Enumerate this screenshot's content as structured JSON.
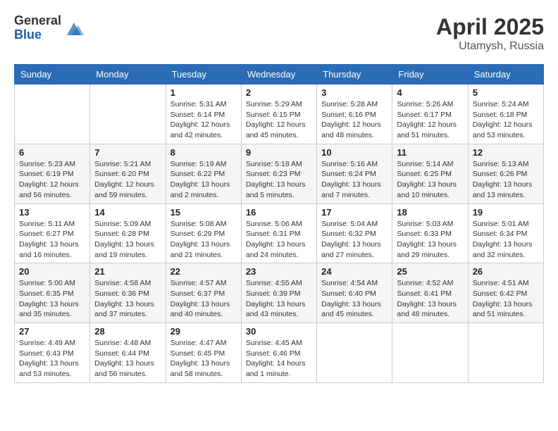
{
  "header": {
    "logo_general": "General",
    "logo_blue": "Blue",
    "month": "April 2025",
    "location": "Utamysh, Russia"
  },
  "days_of_week": [
    "Sunday",
    "Monday",
    "Tuesday",
    "Wednesday",
    "Thursday",
    "Friday",
    "Saturday"
  ],
  "weeks": [
    [
      {
        "day": "",
        "info": ""
      },
      {
        "day": "",
        "info": ""
      },
      {
        "day": "1",
        "info": "Sunrise: 5:31 AM\nSunset: 6:14 PM\nDaylight: 12 hours and 42 minutes."
      },
      {
        "day": "2",
        "info": "Sunrise: 5:29 AM\nSunset: 6:15 PM\nDaylight: 12 hours and 45 minutes."
      },
      {
        "day": "3",
        "info": "Sunrise: 5:28 AM\nSunset: 6:16 PM\nDaylight: 12 hours and 48 minutes."
      },
      {
        "day": "4",
        "info": "Sunrise: 5:26 AM\nSunset: 6:17 PM\nDaylight: 12 hours and 51 minutes."
      },
      {
        "day": "5",
        "info": "Sunrise: 5:24 AM\nSunset: 6:18 PM\nDaylight: 12 hours and 53 minutes."
      }
    ],
    [
      {
        "day": "6",
        "info": "Sunrise: 5:23 AM\nSunset: 6:19 PM\nDaylight: 12 hours and 56 minutes."
      },
      {
        "day": "7",
        "info": "Sunrise: 5:21 AM\nSunset: 6:20 PM\nDaylight: 12 hours and 59 minutes."
      },
      {
        "day": "8",
        "info": "Sunrise: 5:19 AM\nSunset: 6:22 PM\nDaylight: 13 hours and 2 minutes."
      },
      {
        "day": "9",
        "info": "Sunrise: 5:18 AM\nSunset: 6:23 PM\nDaylight: 13 hours and 5 minutes."
      },
      {
        "day": "10",
        "info": "Sunrise: 5:16 AM\nSunset: 6:24 PM\nDaylight: 13 hours and 7 minutes."
      },
      {
        "day": "11",
        "info": "Sunrise: 5:14 AM\nSunset: 6:25 PM\nDaylight: 13 hours and 10 minutes."
      },
      {
        "day": "12",
        "info": "Sunrise: 5:13 AM\nSunset: 6:26 PM\nDaylight: 13 hours and 13 minutes."
      }
    ],
    [
      {
        "day": "13",
        "info": "Sunrise: 5:11 AM\nSunset: 6:27 PM\nDaylight: 13 hours and 16 minutes."
      },
      {
        "day": "14",
        "info": "Sunrise: 5:09 AM\nSunset: 6:28 PM\nDaylight: 13 hours and 19 minutes."
      },
      {
        "day": "15",
        "info": "Sunrise: 5:08 AM\nSunset: 6:29 PM\nDaylight: 13 hours and 21 minutes."
      },
      {
        "day": "16",
        "info": "Sunrise: 5:06 AM\nSunset: 6:31 PM\nDaylight: 13 hours and 24 minutes."
      },
      {
        "day": "17",
        "info": "Sunrise: 5:04 AM\nSunset: 6:32 PM\nDaylight: 13 hours and 27 minutes."
      },
      {
        "day": "18",
        "info": "Sunrise: 5:03 AM\nSunset: 6:33 PM\nDaylight: 13 hours and 29 minutes."
      },
      {
        "day": "19",
        "info": "Sunrise: 5:01 AM\nSunset: 6:34 PM\nDaylight: 13 hours and 32 minutes."
      }
    ],
    [
      {
        "day": "20",
        "info": "Sunrise: 5:00 AM\nSunset: 6:35 PM\nDaylight: 13 hours and 35 minutes."
      },
      {
        "day": "21",
        "info": "Sunrise: 4:58 AM\nSunset: 6:36 PM\nDaylight: 13 hours and 37 minutes."
      },
      {
        "day": "22",
        "info": "Sunrise: 4:57 AM\nSunset: 6:37 PM\nDaylight: 13 hours and 40 minutes."
      },
      {
        "day": "23",
        "info": "Sunrise: 4:55 AM\nSunset: 6:39 PM\nDaylight: 13 hours and 43 minutes."
      },
      {
        "day": "24",
        "info": "Sunrise: 4:54 AM\nSunset: 6:40 PM\nDaylight: 13 hours and 45 minutes."
      },
      {
        "day": "25",
        "info": "Sunrise: 4:52 AM\nSunset: 6:41 PM\nDaylight: 13 hours and 48 minutes."
      },
      {
        "day": "26",
        "info": "Sunrise: 4:51 AM\nSunset: 6:42 PM\nDaylight: 13 hours and 51 minutes."
      }
    ],
    [
      {
        "day": "27",
        "info": "Sunrise: 4:49 AM\nSunset: 6:43 PM\nDaylight: 13 hours and 53 minutes."
      },
      {
        "day": "28",
        "info": "Sunrise: 4:48 AM\nSunset: 6:44 PM\nDaylight: 13 hours and 56 minutes."
      },
      {
        "day": "29",
        "info": "Sunrise: 4:47 AM\nSunset: 6:45 PM\nDaylight: 13 hours and 58 minutes."
      },
      {
        "day": "30",
        "info": "Sunrise: 4:45 AM\nSunset: 6:46 PM\nDaylight: 14 hours and 1 minute."
      },
      {
        "day": "",
        "info": ""
      },
      {
        "day": "",
        "info": ""
      },
      {
        "day": "",
        "info": ""
      }
    ]
  ]
}
